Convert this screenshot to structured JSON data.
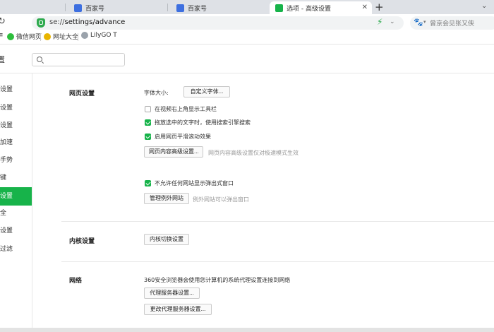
{
  "tabs": [
    {
      "label": "百家号",
      "active": false
    },
    {
      "label": "百家号",
      "active": false
    },
    {
      "label": "选项 - 高级设置",
      "active": true
    }
  ],
  "colors": {
    "accent": "#17b34a",
    "tabbar": "#dee1e6"
  },
  "address": {
    "url_prefix": "se://",
    "url_path": "settings/advance",
    "search_placeholder": "曾京会见张又侠"
  },
  "bookmarks": [
    {
      "label": "微信网页",
      "icon": "wechat-icon"
    },
    {
      "label": "网址大全",
      "icon": "web-directory-icon"
    },
    {
      "label": "LilyGO T",
      "icon": "lilygo-icon"
    }
  ],
  "header": {
    "glyph": "置",
    "search_value": ""
  },
  "nav": [
    {
      "label": "设置",
      "active": false
    },
    {
      "label": "设置",
      "active": false
    },
    {
      "label": "设置",
      "active": false
    },
    {
      "label": "加速",
      "active": false
    },
    {
      "label": "手势",
      "active": false
    },
    {
      "label": "键",
      "active": false
    },
    {
      "label": "设置",
      "active": true
    },
    {
      "label": "全",
      "active": false
    },
    {
      "label": "设置",
      "active": false
    },
    {
      "label": "过滤",
      "active": false
    }
  ],
  "web_settings": {
    "title": "网页设置",
    "font_size_label": "字体大小:",
    "custom_font_button": "自定义字体...",
    "options": [
      {
        "label": "在视频右上角显示工具栏",
        "checked": false
      },
      {
        "label": "拖放选中的文字时，使用搜索引擎搜索",
        "checked": true
      },
      {
        "label": "启用网页平滑滚动效果",
        "checked": true
      }
    ],
    "advanced_button": "网页内容高级设置...",
    "advanced_hint": "网页内容高级设置仅对极速模式生效",
    "popup_option": {
      "label": "不允许任何网站显示弹出式窗口",
      "checked": true
    },
    "exceptions_button": "管理例外网站",
    "exceptions_hint": "例外网站可以弹出窗口"
  },
  "kernel": {
    "title": "内核设置",
    "switch_button": "内核切换设置"
  },
  "network": {
    "title": "网络",
    "description": "360安全浏览器会使用您计算机的系统代理设置连接到网络",
    "proxy_button": "代理服务器设置...",
    "change_proxy_button": "更改代理服务器设置..."
  }
}
